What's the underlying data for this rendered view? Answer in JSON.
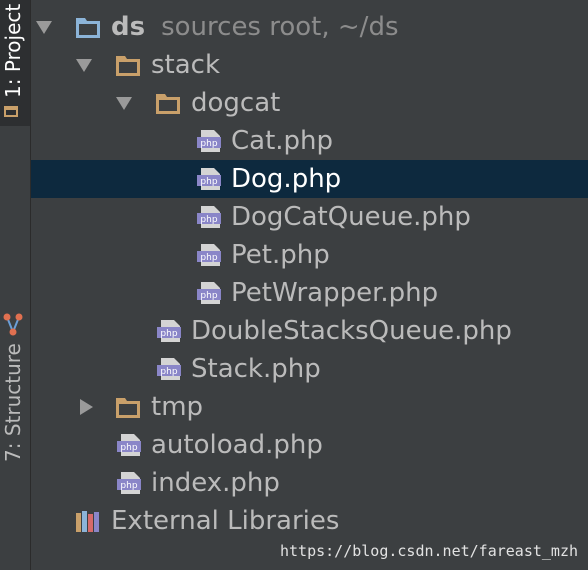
{
  "side_tabs": {
    "project": "1: Project",
    "structure": "7: Structure"
  },
  "tree": {
    "root": {
      "name": "ds",
      "hint": "sources root,  ~/ds"
    },
    "stack": "stack",
    "dogcat": "dogcat",
    "files_dogcat": [
      "Cat.php",
      "Dog.php",
      "DogCatQueue.php",
      "Pet.php",
      "PetWrapper.php"
    ],
    "files_stack": [
      "DoubleStacksQueue.php",
      "Stack.php"
    ],
    "tmp": "tmp",
    "files_root": [
      "autoload.php",
      "index.php"
    ],
    "external": "External Libraries",
    "selected": "Dog.php"
  },
  "file_badge": "php",
  "colors": {
    "background": "#3c3f41",
    "selection": "#0d293e",
    "folder": "#c9a06a",
    "source_root_folder": "#8cb4d8",
    "php_badge": "#8a86c8",
    "text": "#bbbbbb"
  },
  "watermark": "https://blog.csdn.net/fareast_mzh"
}
